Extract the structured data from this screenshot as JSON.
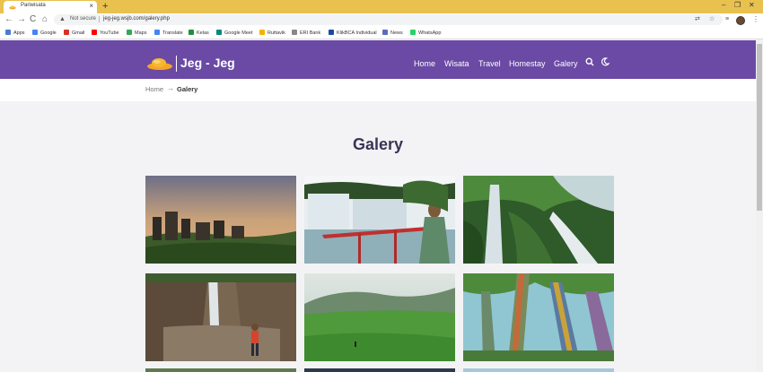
{
  "browser": {
    "tab_title": "Pariwisata",
    "tab_close": "×",
    "new_tab": "+",
    "window_controls": [
      "–",
      "❐",
      "✕"
    ],
    "not_secure": "Not secure",
    "url": "jeg-jeg.wsjb.com/galery.php",
    "nav_icons": [
      "←",
      "→",
      "C",
      "⌂"
    ],
    "bookmarks": [
      {
        "label": "Apps",
        "color": "#4a7bd0"
      },
      {
        "label": "Google",
        "color": "#4285f4"
      },
      {
        "label": "Gmail",
        "color": "#d93025"
      },
      {
        "label": "YouTube",
        "color": "#ff0000"
      },
      {
        "label": "Maps",
        "color": "#34a853"
      },
      {
        "label": "Translate",
        "color": "#4285f4"
      },
      {
        "label": "Kelas",
        "color": "#1e8e3e"
      },
      {
        "label": "Google Meet",
        "color": "#00897b"
      },
      {
        "label": "Ruttavik",
        "color": "#f4b400"
      },
      {
        "label": "ERI Bank",
        "color": "#888888"
      },
      {
        "label": "KlikBCA Individual",
        "color": "#1a4aa0"
      },
      {
        "label": "News",
        "color": "#5c6bc0"
      },
      {
        "label": "WhatsApp",
        "color": "#25d366"
      }
    ]
  },
  "site": {
    "brand": "Jeg - Jeg",
    "nav": [
      "Home",
      "Wisata",
      "Travel",
      "Homestay",
      "Galery"
    ],
    "accent": "#6a4aa5"
  },
  "breadcrumb": {
    "home": "Home",
    "separator": "→",
    "current": "Galery"
  },
  "gallery": {
    "title": "Galery",
    "photos": [
      {
        "name": "rock-pillars-sunset"
      },
      {
        "name": "waterfall-woman-railing"
      },
      {
        "name": "tall-waterfall-valley"
      },
      {
        "name": "canyon-waterfall-hiker"
      },
      {
        "name": "green-meadow-hills"
      },
      {
        "name": "rainbow-eucalyptus-trees"
      }
    ]
  }
}
